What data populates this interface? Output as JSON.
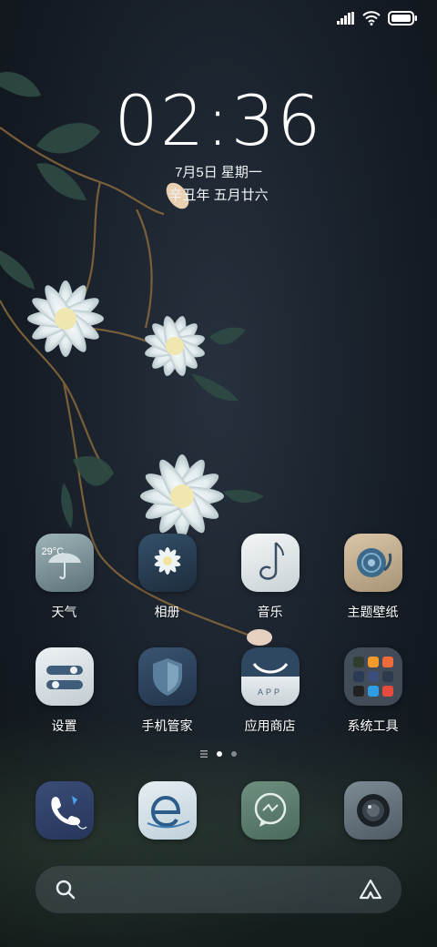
{
  "status_bar": {
    "signal_icon": "signal-bars-icon",
    "wifi_icon": "wifi-icon",
    "battery_icon": "battery-icon"
  },
  "lockscreen": {
    "time": "02:36",
    "date": "7月5日 星期一",
    "lunar_date": "辛丑年 五月廿六"
  },
  "apps_row1": [
    {
      "label": "天气",
      "temp": "29°C"
    },
    {
      "label": "相册"
    },
    {
      "label": "音乐"
    },
    {
      "label": "主题壁纸"
    }
  ],
  "apps_row2": [
    {
      "label": "设置"
    },
    {
      "label": "手机管家"
    },
    {
      "label": "应用商店",
      "badge": "APP"
    },
    {
      "label": "系统工具"
    }
  ],
  "page_indicator": {
    "pages": 3,
    "current": 2
  },
  "dock": [
    {
      "name": "phone"
    },
    {
      "name": "browser"
    },
    {
      "name": "messages"
    },
    {
      "name": "camera"
    }
  ],
  "search_bar": {
    "search_icon": "search-icon",
    "assistant_icon": "assistant-icon"
  }
}
